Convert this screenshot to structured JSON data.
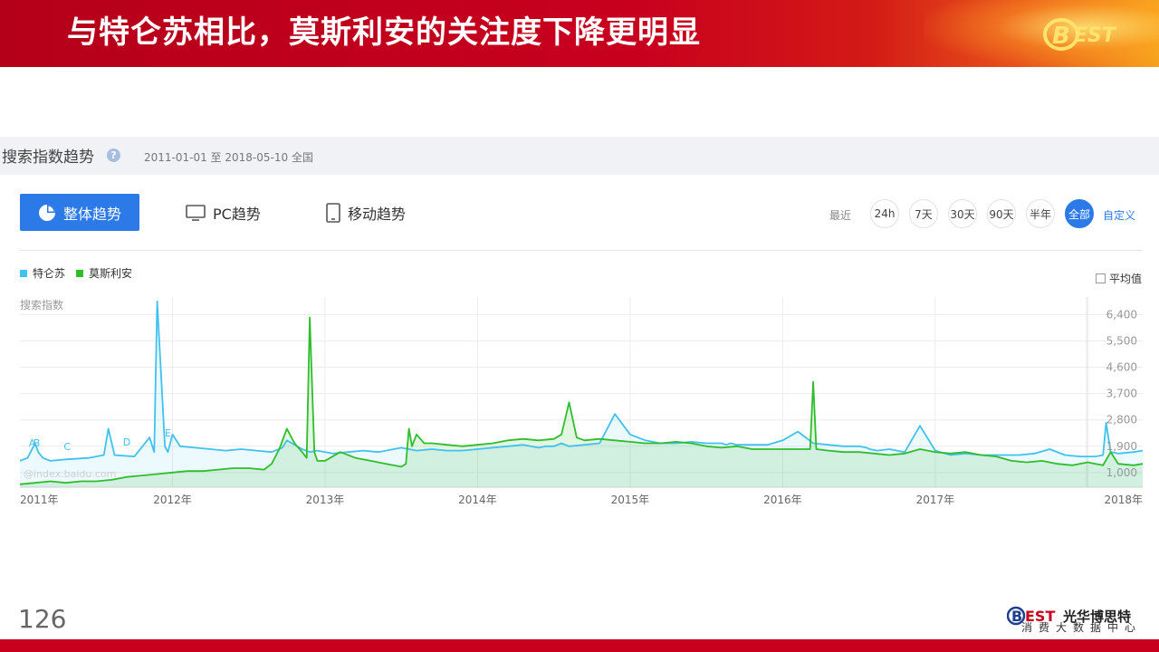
{
  "slide": {
    "title": "与特仑苏相比，莫斯利安的关注度下降更明显",
    "page_number": "126",
    "logo_text": "BEST",
    "footer_brand": "光华博思特",
    "footer_sub": "消费大数据中心",
    "colors": {
      "banner": "#c8001e",
      "accent": "#2c7ae8",
      "series_a": "#41c1f0",
      "series_b": "#2fbd2b"
    }
  },
  "panel": {
    "title": "搜索指数趋势",
    "help_icon": "question-icon",
    "date_range": "2011-01-01 至 2018-05-10",
    "region": "全国",
    "tabs": [
      {
        "label": "整体趋势",
        "icon": "pie-icon",
        "active": true
      },
      {
        "label": "PC趋势",
        "icon": "monitor-icon",
        "active": false
      },
      {
        "label": "移动趋势",
        "icon": "tablet-icon",
        "active": false
      }
    ],
    "recent_label": "最近",
    "time_buttons": [
      "24h",
      "7天",
      "30天",
      "90天",
      "半年",
      "全部"
    ],
    "active_time": "全部",
    "custom_label": "自定义",
    "average_label": "平均值",
    "watermark": "@index.baidu.com"
  },
  "chart_data": {
    "type": "line",
    "ylabel": "搜索指数",
    "y_ticks": [
      "6,400",
      "5,500",
      "4,600",
      "3,700",
      "2,800",
      "1,900",
      "1,000"
    ],
    "ylim": [
      500,
      7000
    ],
    "x_labels": [
      "2011年",
      "2012年",
      "2013年",
      "2014年",
      "2015年",
      "2016年",
      "2017年",
      "2018年"
    ],
    "xlim": [
      2011.0,
      2018.36
    ],
    "annotations": [
      "A",
      "B",
      "C",
      "D",
      "E"
    ],
    "series": [
      {
        "name": "特仑苏",
        "color": "#41c1f0",
        "x": [
          2011.0,
          2011.05,
          2011.1,
          2011.12,
          2011.15,
          2011.2,
          2011.3,
          2011.45,
          2011.55,
          2011.58,
          2011.62,
          2011.75,
          2011.85,
          2011.88,
          2011.9,
          2011.95,
          2011.97,
          2012.0,
          2012.05,
          2012.15,
          2012.25,
          2012.35,
          2012.45,
          2012.55,
          2012.65,
          2012.72,
          2012.75,
          2012.85,
          2012.9,
          2012.95,
          2013.05,
          2013.15,
          2013.25,
          2013.35,
          2013.45,
          2013.5,
          2013.6,
          2013.7,
          2013.8,
          2013.9,
          2014.0,
          2014.1,
          2014.2,
          2014.3,
          2014.4,
          2014.45,
          2014.5,
          2014.55,
          2014.6,
          2014.7,
          2014.8,
          2014.9,
          2015.0,
          2015.1,
          2015.2,
          2015.3,
          2015.4,
          2015.5,
          2015.6,
          2015.63,
          2015.66,
          2015.7,
          2015.8,
          2015.9,
          2016.0,
          2016.1,
          2016.2,
          2016.3,
          2016.4,
          2016.5,
          2016.55,
          2016.57,
          2016.62,
          2016.7,
          2016.8,
          2016.9,
          2017.0,
          2017.1,
          2017.2,
          2017.3,
          2017.38,
          2017.45,
          2017.55,
          2017.65,
          2017.75,
          2017.85,
          2017.95,
          2018.05,
          2018.1,
          2018.12,
          2018.15,
          2018.2,
          2018.3,
          2018.36
        ],
        "y": [
          1400,
          1500,
          2000,
          1700,
          1500,
          1400,
          1450,
          1500,
          1600,
          2500,
          1600,
          1550,
          2200,
          1700,
          6850,
          1900,
          1700,
          2300,
          1900,
          1850,
          1800,
          1750,
          1800,
          1750,
          1700,
          1850,
          2100,
          1800,
          1700,
          1750,
          1650,
          1700,
          1750,
          1700,
          1800,
          1850,
          1750,
          1800,
          1750,
          1750,
          1800,
          1850,
          1900,
          1950,
          1850,
          1900,
          1900,
          2000,
          1900,
          1950,
          2000,
          3000,
          2300,
          2100,
          2000,
          2000,
          2050,
          2000,
          2000,
          1950,
          2000,
          1950,
          1950,
          1950,
          2100,
          2400,
          2000,
          1950,
          1900,
          1900,
          1850,
          1800,
          1750,
          1800,
          1700,
          2600,
          1750,
          1600,
          1650,
          1600,
          1600,
          1600,
          1600,
          1650,
          1800,
          1600,
          1550,
          1550,
          1600,
          2700,
          1700,
          1650,
          1700,
          1750
        ],
        "comment": "estimated"
      },
      {
        "name": "莫斯利安",
        "color": "#2fbd2b",
        "x": [
          2011.0,
          2011.1,
          2011.2,
          2011.3,
          2011.4,
          2011.5,
          2011.6,
          2011.7,
          2011.8,
          2011.9,
          2012.0,
          2012.1,
          2012.2,
          2012.3,
          2012.4,
          2012.5,
          2012.6,
          2012.65,
          2012.7,
          2012.75,
          2012.8,
          2012.85,
          2012.88,
          2012.9,
          2012.93,
          2012.95,
          2013.0,
          2013.1,
          2013.2,
          2013.3,
          2013.4,
          2013.5,
          2013.53,
          2013.55,
          2013.57,
          2013.6,
          2013.65,
          2013.7,
          2013.8,
          2013.9,
          2014.0,
          2014.1,
          2014.2,
          2014.3,
          2014.4,
          2014.5,
          2014.55,
          2014.6,
          2014.65,
          2014.7,
          2014.8,
          2014.9,
          2015.0,
          2015.1,
          2015.2,
          2015.3,
          2015.4,
          2015.5,
          2015.6,
          2015.7,
          2015.8,
          2015.9,
          2016.0,
          2016.1,
          2016.18,
          2016.2,
          2016.22,
          2016.3,
          2016.4,
          2016.5,
          2016.6,
          2016.7,
          2016.8,
          2016.9,
          2017.0,
          2017.1,
          2017.2,
          2017.3,
          2017.4,
          2017.5,
          2017.6,
          2017.7,
          2017.8,
          2017.9,
          2018.0,
          2018.05,
          2018.1,
          2018.15,
          2018.2,
          2018.3,
          2018.36
        ],
        "y": [
          600,
          650,
          700,
          650,
          700,
          700,
          750,
          850,
          900,
          950,
          1000,
          1050,
          1050,
          1100,
          1150,
          1150,
          1100,
          1300,
          1800,
          2500,
          2000,
          1700,
          1500,
          6300,
          1700,
          1400,
          1400,
          1700,
          1500,
          1400,
          1300,
          1200,
          1300,
          2500,
          1900,
          2300,
          2000,
          2000,
          1950,
          1900,
          1950,
          2000,
          2100,
          2150,
          2100,
          2150,
          2300,
          3400,
          2200,
          2100,
          2150,
          2100,
          2050,
          2000,
          2000,
          2050,
          2000,
          1900,
          1850,
          1900,
          1800,
          1800,
          1800,
          1800,
          1800,
          4100,
          1800,
          1750,
          1700,
          1700,
          1650,
          1600,
          1650,
          1800,
          1700,
          1650,
          1700,
          1600,
          1550,
          1400,
          1350,
          1400,
          1300,
          1250,
          1350,
          1300,
          1250,
          1700,
          1300,
          1250,
          1300
        ],
        "comment": "estimated"
      }
    ]
  }
}
